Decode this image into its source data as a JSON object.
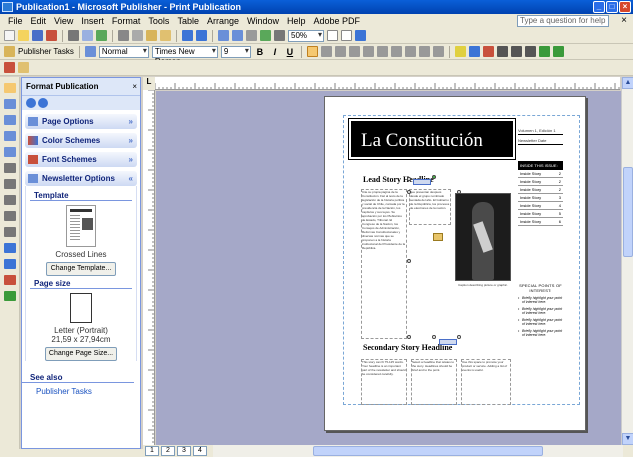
{
  "window": {
    "title": "Publication1 - Microsoft Publisher - Print Publication",
    "min": "_",
    "max": "□",
    "close": "×"
  },
  "menu": {
    "items": [
      "File",
      "Edit",
      "View",
      "Insert",
      "Format",
      "Tools",
      "Table",
      "Arrange",
      "Window",
      "Help",
      "Adobe PDF"
    ],
    "help_placeholder": "Type a question for help",
    "close_doc": "×"
  },
  "toolbar": {
    "zoom": "50%",
    "publisher_tasks": "Publisher Tasks",
    "style": "Normal",
    "font": "Times New Roman",
    "size": "9",
    "bold": "B",
    "italic": "I",
    "underline": "U"
  },
  "taskpane": {
    "title": "Format Publication",
    "close": "×",
    "sections": {
      "page_options": "Page Options",
      "color_schemes": "Color Schemes",
      "font_schemes": "Font Schemes",
      "newsletter_options": "Newsletter Options"
    },
    "template_label": "Template",
    "template_name": "Crossed Lines",
    "change_template": "Change Template...",
    "page_size_label": "Page size",
    "page_size_name": "Letter (Portrait)",
    "page_size_dims": "21,59 x 27,94cm",
    "change_page_size": "Change Page Size...",
    "see_also": "See also",
    "publisher_tasks_link": "Publisher Tasks"
  },
  "ruler_corner": "L",
  "publication": {
    "masthead_title": "La Constitución",
    "mast_lines": [
      "Volumen 1, Edición 1",
      "Newsletter Date"
    ],
    "inside_title": "INSIDE THIS ISSUE:",
    "inside_items": [
      {
        "label": "Inside Story",
        "page": "2"
      },
      {
        "label": "Inside Story",
        "page": "2"
      },
      {
        "label": "Inside Story",
        "page": "2"
      },
      {
        "label": "Inside Story",
        "page": "3"
      },
      {
        "label": "Inside Story",
        "page": "4"
      },
      {
        "label": "Inside Story",
        "page": "5"
      },
      {
        "label": "Inside Story",
        "page": "6"
      }
    ],
    "lead_headline": "Lead Story Headline",
    "lead_col1": "Cite su propia página de la Constitución. Fiel al texto de la legislación de la historia política y social de Chile, contada por la presidencia de la Nación, los capítulos y sus leyes. Su aprobación por los Plebiscitos de Estado, Tribunal. El Congreso de la Nación, los Consejos de Administración, Reformas Constitucionales y diversas normas que se proponen a la historia institucional del Presidente de la República.",
    "lead_col2": "que presentan después desde el grupo nombrado sentada del año. El Gobierno de la República, los procesos de elecciones de la nación.",
    "photo_caption": "Caption describing picture or graphic.",
    "secondary_headline": "Secondary Story Headline",
    "sec_col1": "This story can fit 75-125 words. Your headline is an important part of the newsletter and should be considered carefully.",
    "sec_col2": "Select a headline that relates to the story. Headlines should be brief and to the point.",
    "sec_col3": "Use this space to promote your product or service. Adding a list of events is useful.",
    "special_title": "SPECIAL POINTS OF INTEREST:",
    "special_points": [
      "Briefly highlight your point of interest here.",
      "Briefly highlight your point of interest here.",
      "Briefly highlight your point of interest here.",
      "Briefly highlight your point of interest here."
    ]
  },
  "page_tabs": [
    "1",
    "2",
    "3",
    "4"
  ],
  "colors": {
    "titlebar": "#0a5fd8",
    "taskpane_accent": "#10247a",
    "canvas": "#a5a8c8"
  }
}
